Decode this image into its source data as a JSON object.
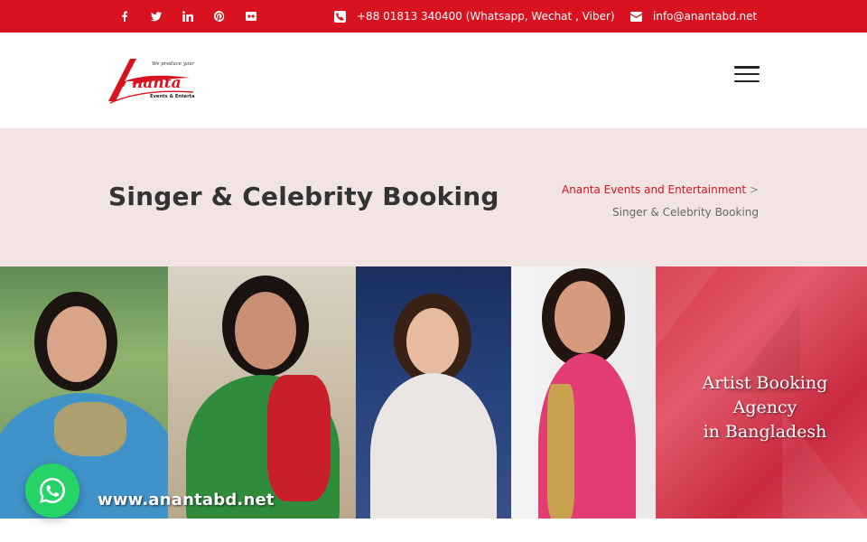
{
  "topbar": {
    "social": [
      {
        "icon": "facebook-icon",
        "glyph": "f"
      },
      {
        "icon": "twitter-icon",
        "glyph": "t"
      },
      {
        "icon": "linkedin-icon",
        "glyph": "in"
      },
      {
        "icon": "pinterest-icon",
        "glyph": "p"
      },
      {
        "icon": "flickr-icon",
        "glyph": "fl"
      }
    ],
    "phone": "+88 01813 340400 (Whatsapp, Wechat , Viber)",
    "email": "info@anantabd.net",
    "background": "#d8131f"
  },
  "header": {
    "logo": {
      "tagline": "We produce your ideas...",
      "name": "Ananta",
      "subtitle": "Events & Entertainment"
    },
    "menu_icon": "hamburger-menu-icon"
  },
  "titlebar": {
    "title": "Singer & Celebrity Booking",
    "breadcrumb": {
      "home": "Ananta Events and Entertainment",
      "separator": ">",
      "current": "Singer & Celebrity Booking"
    }
  },
  "banner": {
    "caption_line1": "Artist Booking Agency",
    "caption_line2": "in Bangladesh",
    "url": "www.anantabd.net"
  },
  "whatsapp": {
    "icon": "whatsapp-icon",
    "color": "#25d366"
  }
}
